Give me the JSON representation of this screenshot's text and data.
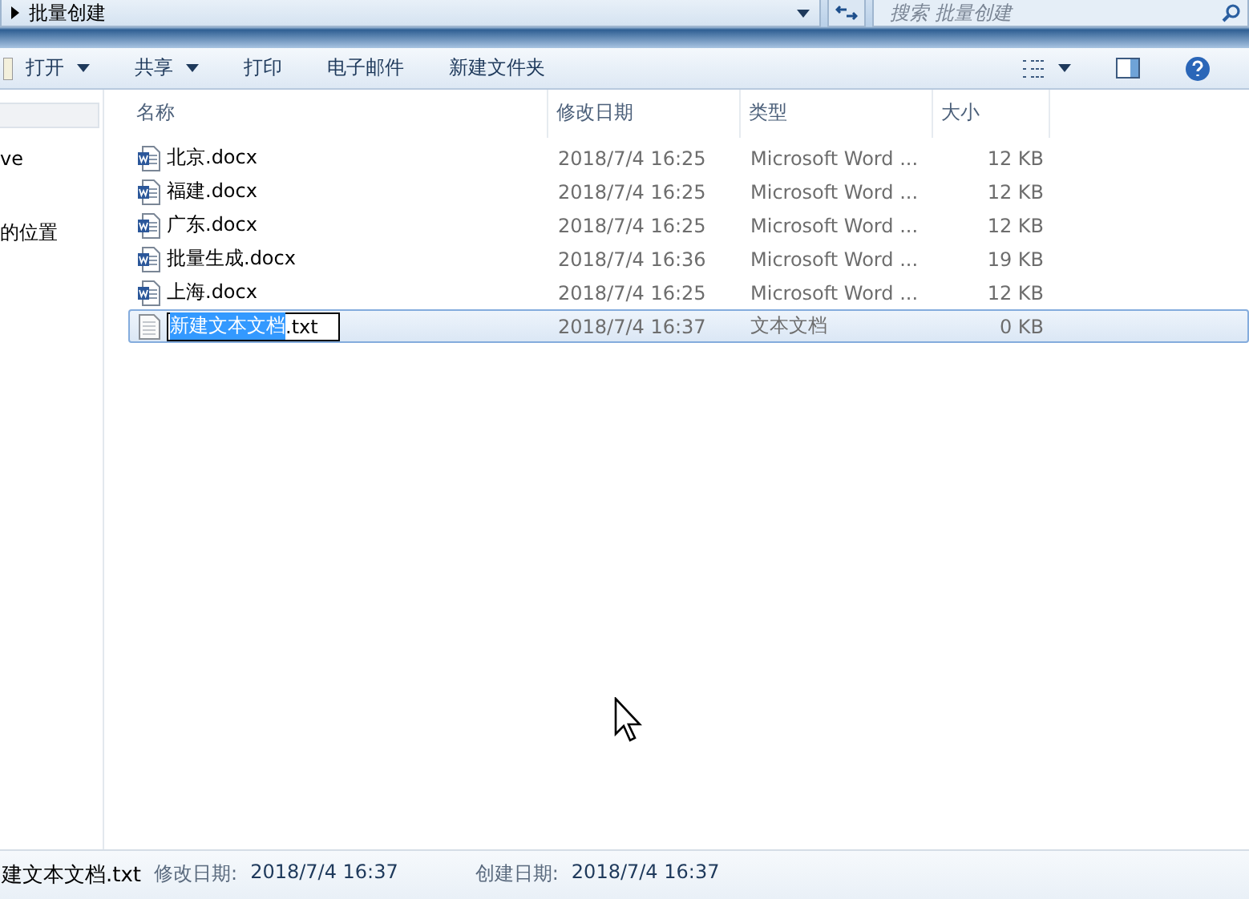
{
  "address": {
    "path": "批量创建",
    "search_placeholder": "搜索 批量创建"
  },
  "toolbar": {
    "buttons": [
      {
        "label": "打开",
        "dropdown": true
      },
      {
        "label": "共享",
        "dropdown": true
      },
      {
        "label": "打印",
        "dropdown": false
      },
      {
        "label": "电子邮件",
        "dropdown": false
      },
      {
        "label": "新建文件夹",
        "dropdown": false
      }
    ]
  },
  "sidebar": {
    "items": [
      {
        "label": "ve"
      },
      {
        "label": "的位置"
      }
    ]
  },
  "table": {
    "columns": [
      "名称",
      "修改日期",
      "类型",
      "大小"
    ],
    "rows": [
      {
        "kind": "word",
        "name": "北京.docx",
        "date": "2018/7/4 16:25",
        "type": "Microsoft Word ...",
        "size": "12 KB",
        "selected": false
      },
      {
        "kind": "word",
        "name": "福建.docx",
        "date": "2018/7/4 16:25",
        "type": "Microsoft Word ...",
        "size": "12 KB",
        "selected": false
      },
      {
        "kind": "word",
        "name": "广东.docx",
        "date": "2018/7/4 16:25",
        "type": "Microsoft Word ...",
        "size": "12 KB",
        "selected": false
      },
      {
        "kind": "word",
        "name": "批量生成.docx",
        "date": "2018/7/4 16:36",
        "type": "Microsoft Word ...",
        "size": "19 KB",
        "selected": false
      },
      {
        "kind": "word",
        "name": "上海.docx",
        "date": "2018/7/4 16:25",
        "type": "Microsoft Word ...",
        "size": "12 KB",
        "selected": false
      },
      {
        "kind": "text",
        "rename": {
          "highlighted": "新建文本文档",
          "rest": ".txt"
        },
        "date": "2018/7/4 16:37",
        "type": "文本文档",
        "size": "0 KB",
        "selected": true
      }
    ]
  },
  "details": {
    "name": "建文本文档.txt",
    "fields": [
      {
        "label": "修改日期:",
        "value": "2018/7/4 16:37"
      },
      {
        "label": "创建日期:",
        "value": "2018/7/4 16:37"
      }
    ]
  }
}
